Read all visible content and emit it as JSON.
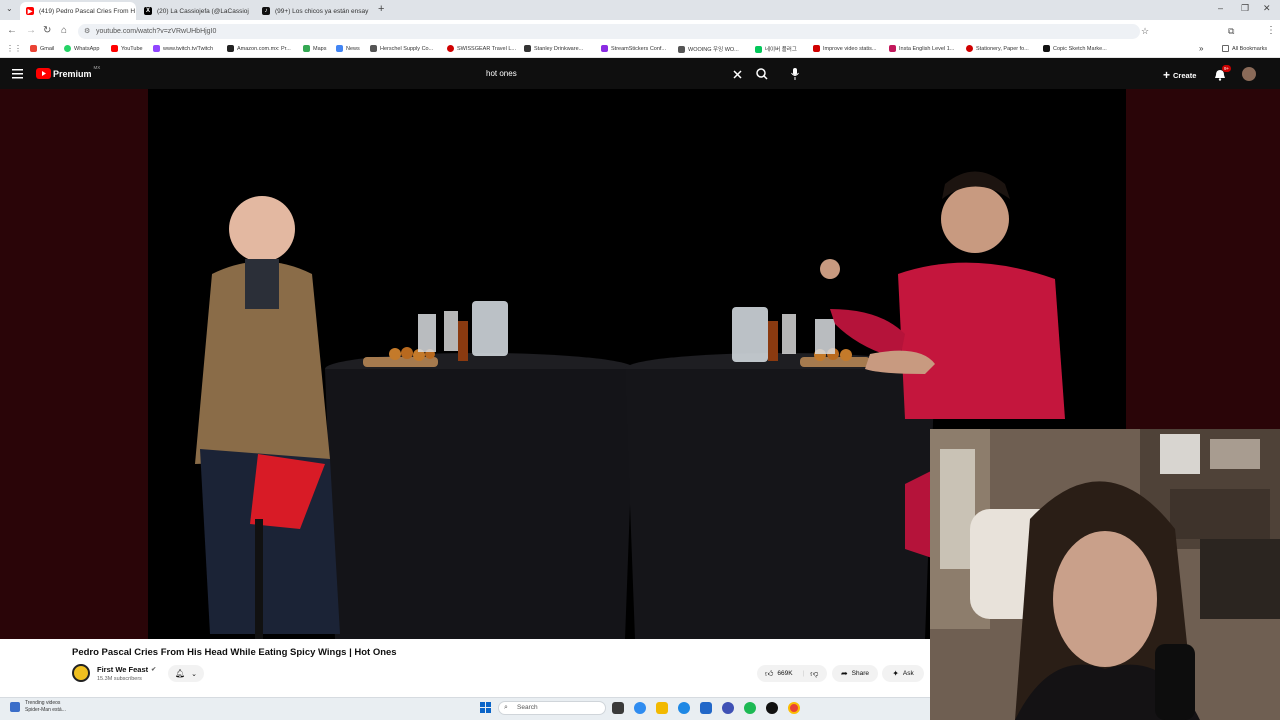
{
  "browser": {
    "tabs": [
      {
        "title": "(419) Pedro Pascal Cries From H",
        "active": true
      },
      {
        "title": "(20) La Cassiojefa (@LaCassioj",
        "active": false
      },
      {
        "title": "(99+) Los chicos ya están ensay",
        "active": false
      }
    ],
    "new_tab_label": "+",
    "address": "youtube.com/watch?v=zVRwUHbHjgI0",
    "bookmarks": [
      {
        "label": "Gmail",
        "color": "#ea4335"
      },
      {
        "label": "WhatsApp",
        "color": "#25d366"
      },
      {
        "label": "YouTube",
        "color": "#ff0000"
      },
      {
        "label": "www.twitch.tv/Twitch",
        "color": "#9146ff"
      },
      {
        "label": "Amazon.com.mx: Pr...",
        "color": "#222222"
      },
      {
        "label": "Maps",
        "color": "#34a853"
      },
      {
        "label": "News",
        "color": "#4285f4"
      },
      {
        "label": "Herschel Supply Co...",
        "color": "#555555"
      },
      {
        "label": "SWISSGEAR Travel L...",
        "color": "#d00000"
      },
      {
        "label": "Stanley Drinkware...",
        "color": "#333333"
      },
      {
        "label": "StreamStickers Conf...",
        "color": "#8a2be2"
      },
      {
        "label": "WOOING 우잉 WO...",
        "color": "#555555"
      },
      {
        "label": "네이버 플러그",
        "color": "#03c75a"
      },
      {
        "label": "Improve video statis...",
        "color": "#d00000"
      },
      {
        "label": "Insta English Level 1...",
        "color": "#c2185b"
      },
      {
        "label": "Stationery, Paper fo...",
        "color": "#d00000"
      },
      {
        "label": "Copic Sketch Marke...",
        "color": "#111111"
      }
    ],
    "all_bookmarks": "All Bookmarks"
  },
  "youtube": {
    "logo_text": "Premium",
    "logo_region": "MX",
    "search_value": "hot ones",
    "create_label": "Create",
    "notif_badge": "9+",
    "video_title": "Pedro Pascal Cries From His Head While Eating Spicy Wings | Hot Ones",
    "channel_name": "First We Feast",
    "subscribers": "15.3M subscribers",
    "likes": "669K",
    "share_label": "Share",
    "ask_label": "Ask"
  },
  "taskbar": {
    "widget_title": "Trending videos",
    "widget_sub": "Spider-Man está...",
    "search_placeholder": "Search"
  },
  "colors": {
    "accent": "#ff0000",
    "video_side": "#2a0508"
  }
}
